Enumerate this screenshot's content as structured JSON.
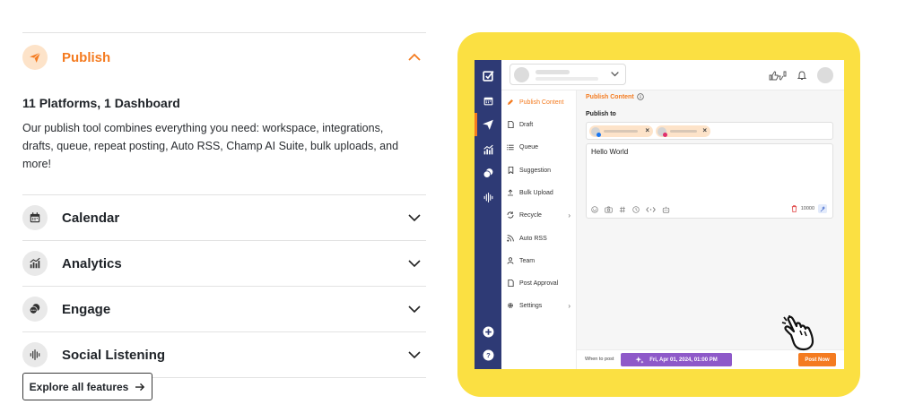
{
  "accordion": {
    "active": {
      "title": "Publish",
      "icon": "paper-plane-icon",
      "subtitle": "11 Platforms, 1 Dashboard",
      "description": "Our publish tool combines everything you need: workspace, integrations, drafts, queue, repeat posting, Auto RSS, Champ AI Suite, bulk uploads, and more!"
    },
    "items": [
      {
        "title": "Calendar",
        "icon": "calendar-icon"
      },
      {
        "title": "Analytics",
        "icon": "analytics-icon"
      },
      {
        "title": "Engage",
        "icon": "chat-bubbles-icon"
      },
      {
        "title": "Social Listening",
        "icon": "sound-wave-icon"
      }
    ]
  },
  "explore": {
    "label": "Explore all features",
    "icon": "arrow-right-icon"
  },
  "mockup": {
    "menu": {
      "publish_content": "Publish Content",
      "draft": "Draft",
      "queue": "Queue",
      "suggestion": "Suggestion",
      "bulk_upload": "Bulk Upload",
      "recycle": "Recycle",
      "auto_rss": "Auto RSS",
      "team": "Team",
      "post_approval": "Post Approval",
      "settings": "Settings"
    },
    "content": {
      "title": "Publish Content",
      "publish_to": "Publish to",
      "editor_text": "Hello World",
      "char_count": "10000"
    },
    "footer": {
      "when_label": "When to post",
      "date": "Fri, Apr 01, 2024, 01:00 PM",
      "post_now": "Post Now"
    }
  },
  "colors": {
    "accent": "#f47b20",
    "yellow": "#fbe042",
    "rail": "#2e3a75",
    "date_button": "#8e59c9"
  }
}
